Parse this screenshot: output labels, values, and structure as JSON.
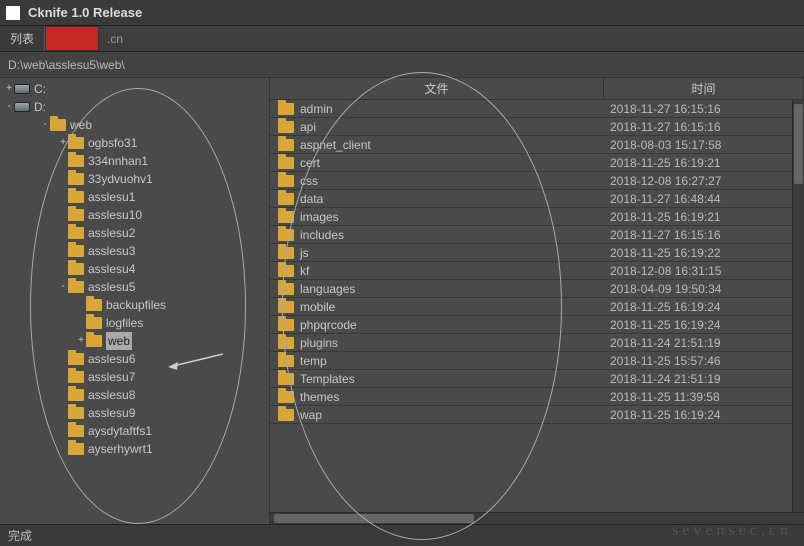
{
  "titlebar": {
    "title": "Cknife 1.0 Release"
  },
  "tabs": {
    "list_label": "列表",
    "domain_suffix": ".cn"
  },
  "path": "D:\\web\\asslesu5\\web\\",
  "tree": {
    "drives": [
      "C:",
      "D:"
    ],
    "d_children": [
      {
        "label": "web",
        "depth": 2,
        "expander": "-"
      },
      {
        "label": "ogbsfo31",
        "depth": 3,
        "expander": "+"
      },
      {
        "label": "334nnhan1",
        "depth": 3,
        "expander": ""
      },
      {
        "label": "33ydvuohv1",
        "depth": 3,
        "expander": ""
      },
      {
        "label": "asslesu1",
        "depth": 3,
        "expander": ""
      },
      {
        "label": "asslesu10",
        "depth": 3,
        "expander": ""
      },
      {
        "label": "asslesu2",
        "depth": 3,
        "expander": ""
      },
      {
        "label": "asslesu3",
        "depth": 3,
        "expander": ""
      },
      {
        "label": "asslesu4",
        "depth": 3,
        "expander": ""
      },
      {
        "label": "asslesu5",
        "depth": 3,
        "expander": "-"
      },
      {
        "label": "backupfiles",
        "depth": 4,
        "expander": ""
      },
      {
        "label": "logfiles",
        "depth": 4,
        "expander": ""
      },
      {
        "label": "web",
        "depth": 4,
        "expander": "+",
        "selected": true
      },
      {
        "label": "asslesu6",
        "depth": 3,
        "expander": ""
      },
      {
        "label": "asslesu7",
        "depth": 3,
        "expander": ""
      },
      {
        "label": "asslesu8",
        "depth": 3,
        "expander": ""
      },
      {
        "label": "asslesu9",
        "depth": 3,
        "expander": ""
      },
      {
        "label": "aysdytaftfs1",
        "depth": 3,
        "expander": ""
      },
      {
        "label": "ayserhywrt1",
        "depth": 3,
        "expander": ""
      }
    ]
  },
  "list": {
    "headers": {
      "name": "文件",
      "time": "时间"
    },
    "rows": [
      {
        "name": "admin",
        "time": "2018-11-27 16:15:16"
      },
      {
        "name": "api",
        "time": "2018-11-27 16:15:16"
      },
      {
        "name": "aspnet_client",
        "time": "2018-08-03 15:17:58"
      },
      {
        "name": "cert",
        "time": "2018-11-25 16:19:21"
      },
      {
        "name": "css",
        "time": "2018-12-08 16:27:27"
      },
      {
        "name": "data",
        "time": "2018-11-27 16:48:44"
      },
      {
        "name": "images",
        "time": "2018-11-25 16:19:21"
      },
      {
        "name": "includes",
        "time": "2018-11-27 16:15:16"
      },
      {
        "name": "js",
        "time": "2018-11-25 16:19:22"
      },
      {
        "name": "kf",
        "time": "2018-12-08 16:31:15"
      },
      {
        "name": "languages",
        "time": "2018-04-09 19:50:34"
      },
      {
        "name": "mobile",
        "time": "2018-11-25 16:19:24"
      },
      {
        "name": "phpqrcode",
        "time": "2018-11-25 16:19:24"
      },
      {
        "name": "plugins",
        "time": "2018-11-24 21:51:19"
      },
      {
        "name": "temp",
        "time": "2018-11-25 15:57:46"
      },
      {
        "name": "Templates",
        "time": "2018-11-24 21:51:19"
      },
      {
        "name": "themes",
        "time": "2018-11-25 11:39:58"
      },
      {
        "name": "wap",
        "time": "2018-11-25 16:19:24"
      }
    ]
  },
  "status": "完成",
  "watermark": "sevensec.cn"
}
